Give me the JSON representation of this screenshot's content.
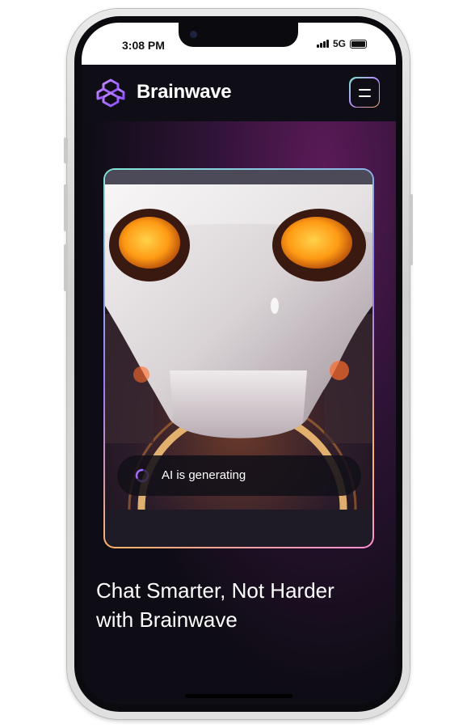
{
  "status_bar": {
    "time": "3:08 PM",
    "network": "5G"
  },
  "header": {
    "brand": "Brainwave",
    "logo_icon": "brainwave-logo-icon",
    "menu_icon": "hamburger-menu-icon"
  },
  "hero": {
    "status_text": "AI is generating",
    "status_icon": "loading-spinner-icon"
  },
  "headline": {
    "line1": "Chat Smarter, Not Harder",
    "line2": "with Brainwave"
  },
  "colors": {
    "background": "#0e0c14",
    "accent_purple": "#a46bff",
    "glow_orange": "#ffb36a",
    "glow_pink": "#ff8fd6",
    "glow_teal": "#7fe6d6"
  }
}
